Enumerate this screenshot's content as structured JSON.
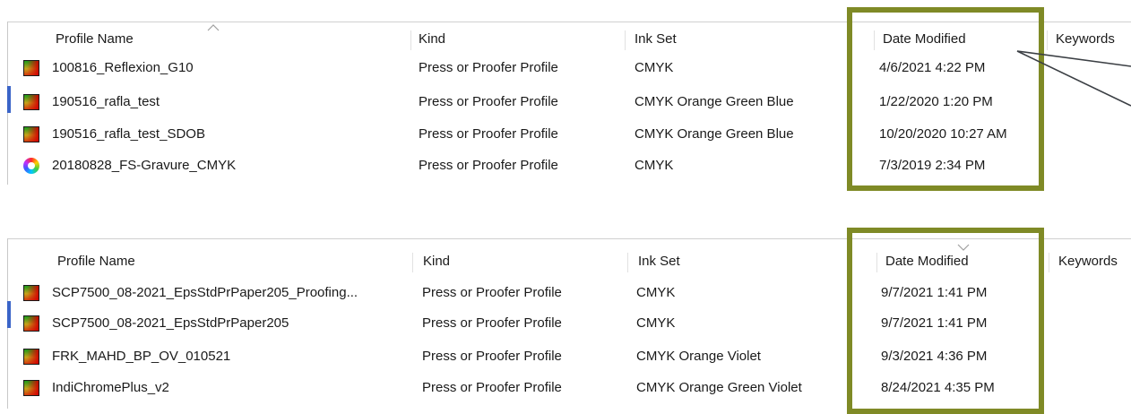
{
  "columns": {
    "profile_name": "Profile Name",
    "kind": "Kind",
    "ink_set": "Ink Set",
    "date_modified": "Date Modified",
    "keywords": "Keywords"
  },
  "list1": {
    "rows": [
      {
        "name": "100816_Reflexion_G10",
        "kind": "Press or Proofer Profile",
        "ink_set": "CMYK",
        "date": "4/6/2021 4:22 PM",
        "icon": "gradient-profile-icon"
      },
      {
        "name": "190516_rafla_test",
        "kind": "Press or Proofer Profile",
        "ink_set": "CMYK Orange Green Blue",
        "date": "1/22/2020 1:20 PM",
        "icon": "gradient-profile-icon"
      },
      {
        "name": "190516_rafla_test_SDOB",
        "kind": "Press or Proofer Profile",
        "ink_set": "CMYK Orange Green Blue",
        "date": "10/20/2020 10:27 AM",
        "icon": "gradient-profile-icon"
      },
      {
        "name": "20180828_FS-Gravure_CMYK",
        "kind": "Press or Proofer Profile",
        "ink_set": "CMYK",
        "date": "7/3/2019 2:34 PM",
        "icon": "color-wheel-icon"
      }
    ]
  },
  "list2": {
    "rows": [
      {
        "name": "SCP7500_08-2021_EpsStdPrPaper205_Proofing...",
        "kind": "Press or Proofer Profile",
        "ink_set": "CMYK",
        "date": "9/7/2021 1:41 PM",
        "icon": "gradient-profile-icon"
      },
      {
        "name": "SCP7500_08-2021_EpsStdPrPaper205",
        "kind": "Press or Proofer Profile",
        "ink_set": "CMYK",
        "date": "9/7/2021 1:41 PM",
        "icon": "gradient-profile-icon"
      },
      {
        "name": "FRK_MAHD_BP_OV_010521",
        "kind": "Press or Proofer Profile",
        "ink_set": "CMYK Orange Violet",
        "date": "9/3/2021 4:36 PM",
        "icon": "gradient-profile-icon"
      },
      {
        "name": "IndiChromePlus_v2",
        "kind": "Press or Proofer Profile",
        "ink_set": "CMYK Orange Green Violet",
        "date": "8/24/2021 4:35 PM",
        "icon": "gradient-profile-icon"
      }
    ]
  },
  "colors": {
    "highlight_box": "#7f8a26",
    "selection_bar": "#3a64c8",
    "column_separator": "#e1e1e1"
  }
}
